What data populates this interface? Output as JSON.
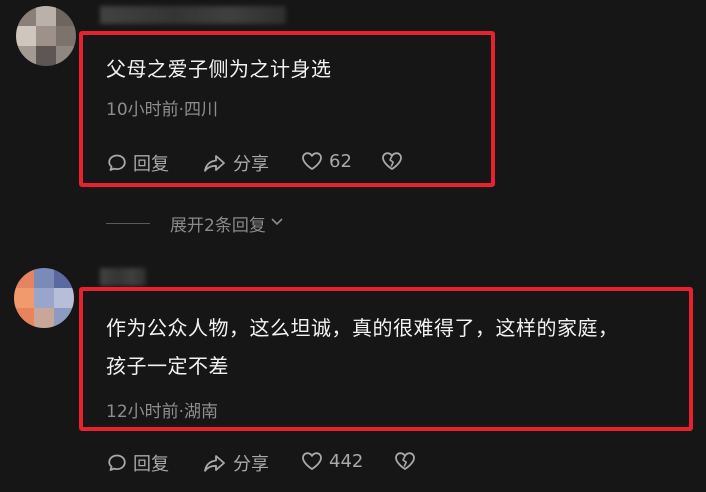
{
  "comments": [
    {
      "text_lines": [
        "父母之爱子侧为之计身选"
      ],
      "meta": "10小时前·四川",
      "reply_label": "回复",
      "share_label": "分享",
      "likes": "62",
      "expand_replies": "展开2条回复"
    },
    {
      "text_lines": [
        "作为公众人物，这么坦诚，真的很难得了，这样的家庭，",
        "孩子一定不差"
      ],
      "meta": "12小时前·湖南",
      "reply_label": "回复",
      "share_label": "分享",
      "likes": "442"
    }
  ],
  "icons": {
    "reply": "speech-bubble-icon",
    "share": "share-arrow-icon",
    "like": "heart-icon",
    "dislike": "broken-heart-icon",
    "expand": "chevron-down-icon"
  },
  "colors": {
    "background": "#161616",
    "highlight": "#e8212e",
    "text": "#f2f2f2",
    "muted": "#8d8d8d"
  }
}
